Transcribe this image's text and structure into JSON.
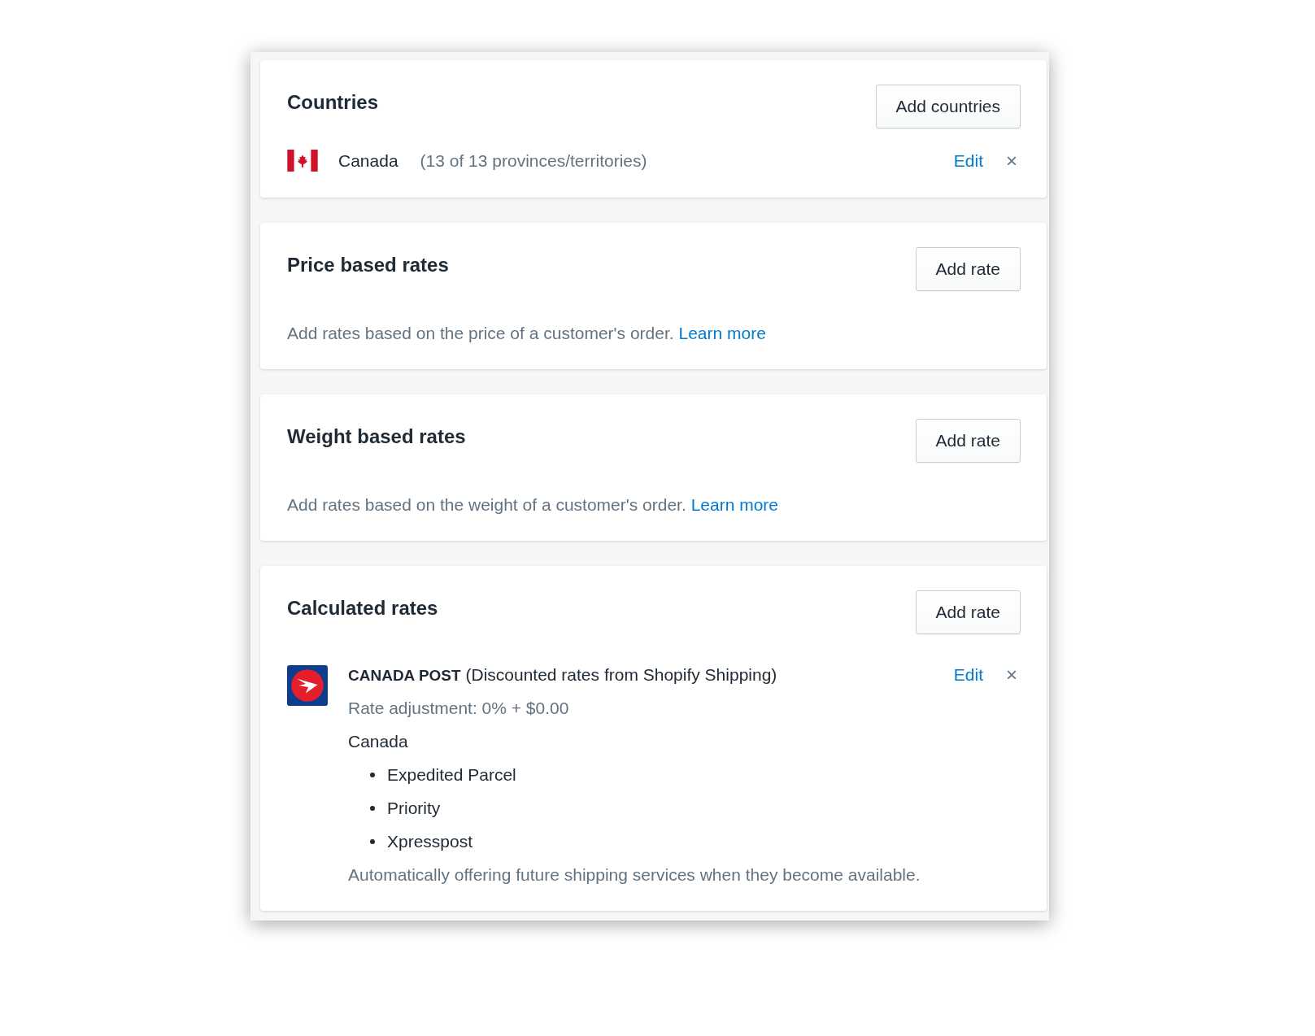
{
  "cards": [
    {
      "kind": "countries",
      "title": "Countries",
      "button": "Add countries",
      "country": {
        "name": "Canada",
        "detail": "(13 of 13 provinces/territories)",
        "edit": "Edit",
        "remove": "×"
      }
    },
    {
      "kind": "info",
      "title": "Price based rates",
      "button": "Add rate",
      "text": "Add rates based on the price of a customer's order.",
      "link": "Learn more"
    },
    {
      "kind": "info",
      "title": "Weight based rates",
      "button": "Add rate",
      "text": "Add rates based on the weight of a customer's order.",
      "link": "Learn more"
    },
    {
      "kind": "carrier",
      "title": "Calculated rates",
      "button": "Add rate",
      "carrier": {
        "name": "**CANADA POST** (Discounted rates from Shopify Shipping)",
        "adjustment": "Rate adjustment: 0% + $0.00",
        "region": "Canada",
        "services": [
          "Expedited Parcel",
          "Priority",
          "Xpresspost"
        ],
        "note": "Automatically offering future shipping services when they become available.",
        "edit": "Edit",
        "remove": "×"
      }
    }
  ]
}
